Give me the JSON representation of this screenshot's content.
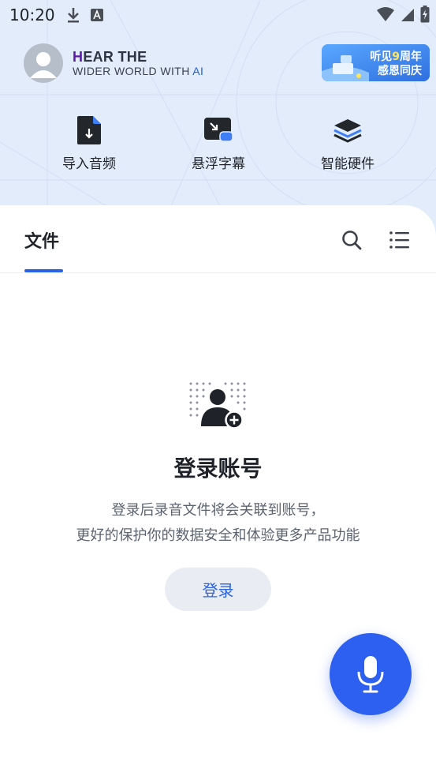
{
  "status_bar": {
    "time": "10:20",
    "icons": [
      "download-icon",
      "keyboard-a-icon",
      "wifi-icon",
      "signal-icon",
      "battery-charging-icon"
    ]
  },
  "header": {
    "avatar_icon": "user-avatar-icon",
    "slogan_line1_first": "H",
    "slogan_line1_rest": "EAR THE",
    "slogan_line2_main": "WIDER WORLD WITH ",
    "slogan_line2_ai": "AI",
    "banner": {
      "line1_prefix": "听见",
      "line1_number": "9",
      "line1_suffix": "周年",
      "line2": "感恩同庆"
    }
  },
  "quick_actions": [
    {
      "label": "导入音频",
      "icon": "import-audio-icon"
    },
    {
      "label": "悬浮字幕",
      "icon": "floating-subtitle-icon"
    },
    {
      "label": "智能硬件",
      "icon": "smart-hardware-icon"
    }
  ],
  "tabs": {
    "active": "文件",
    "search_icon": "search-icon",
    "menu_icon": "list-menu-icon"
  },
  "empty_state": {
    "icon": "add-user-icon",
    "title": "登录账号",
    "desc_line1": "登录后录音文件将会关联到账号，",
    "desc_line2": "更好的保护你的数据安全和体验更多产品功能",
    "button_label": "登录"
  },
  "fab": {
    "icon": "microphone-icon"
  },
  "colors": {
    "accent": "#2a63e6",
    "hero_bg": "#e3ecfb",
    "fab": "#2d5ff0"
  }
}
